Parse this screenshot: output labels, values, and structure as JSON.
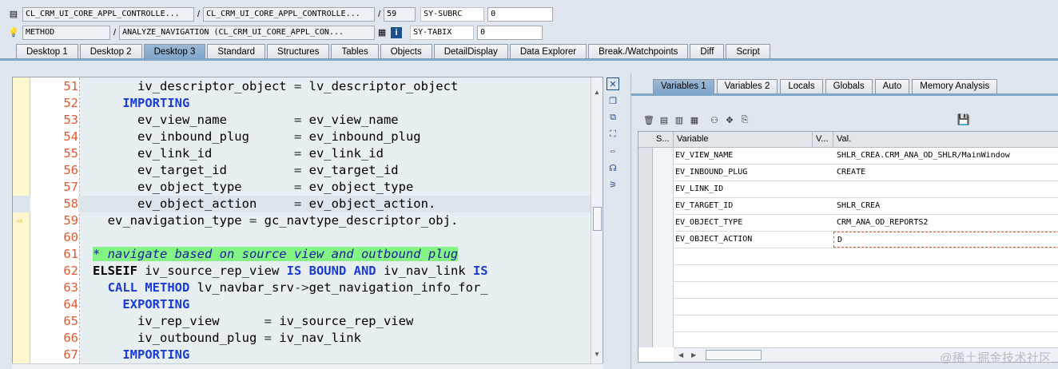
{
  "info": {
    "row1": {
      "field1": "CL_CRM_UI_CORE_APPL_CONTROLLE...",
      "field2": "CL_CRM_UI_CORE_APPL_CONTROLLE...",
      "line": "59",
      "label": "SY-SUBRC",
      "value": "0"
    },
    "row2": {
      "kind": "METHOD",
      "method": "ANALYZE_NAVIGATION (CL_CRM_UI_CORE_APPL_CON...",
      "label": "SY-TABIX",
      "value": "0"
    }
  },
  "tabs": [
    "Desktop 1",
    "Desktop 2",
    "Desktop 3",
    "Standard",
    "Structures",
    "Tables",
    "Objects",
    "DetailDisplay",
    "Data Explorer",
    "Break./Watchpoints",
    "Diff",
    "Script"
  ],
  "active_tab": "Desktop 3",
  "code": {
    "lines": [
      {
        "no": "51",
        "text": "      iv_descriptor_object = lv_descriptor_object"
      },
      {
        "no": "52",
        "text": "    IMPORTING"
      },
      {
        "no": "53",
        "text": "      ev_view_name         = ev_view_name"
      },
      {
        "no": "54",
        "text": "      ev_inbound_plug      = ev_inbound_plug"
      },
      {
        "no": "55",
        "text": "      ev_link_id           = ev_link_id"
      },
      {
        "no": "56",
        "text": "      ev_target_id         = ev_target_id"
      },
      {
        "no": "57",
        "text": "      ev_object_type       = ev_object_type"
      },
      {
        "no": "58",
        "text": "      ev_object_action     = ev_object_action."
      },
      {
        "no": "59",
        "text": "  ev_navigation_type = gc_navtype_descriptor_obj."
      },
      {
        "no": "60",
        "text": ""
      },
      {
        "no": "61",
        "text": "* navigate based on source view and outbound plug"
      },
      {
        "no": "62",
        "text": "ELSEIF iv_source_rep_view IS BOUND AND iv_nav_link IS"
      },
      {
        "no": "63",
        "text": "  CALL METHOD lv_navbar_srv->get_navigation_info_for_"
      },
      {
        "no": "64",
        "text": "    EXPORTING"
      },
      {
        "no": "65",
        "text": "      iv_rep_view      = iv_source_rep_view"
      },
      {
        "no": "66",
        "text": "      iv_outbound_plug = iv_nav_link"
      },
      {
        "no": "67",
        "text": "    IMPORTING"
      }
    ]
  },
  "right": {
    "tabs": [
      "Variables 1",
      "Variables 2",
      "Locals",
      "Globals",
      "Auto",
      "Memory Analysis"
    ],
    "active_tab": "Variables 1",
    "headers": {
      "s": "S...",
      "variable": "Variable",
      "v": "V...",
      "val": "Val."
    },
    "rows": [
      {
        "variable": "EV_VIEW_NAME",
        "value": "SHLR_CREA.CRM_ANA_OD_SHLR/MainWindow"
      },
      {
        "variable": "EV_INBOUND_PLUG",
        "value": "CREATE"
      },
      {
        "variable": "EV_LINK_ID",
        "value": ""
      },
      {
        "variable": "EV_TARGET_ID",
        "value": "SHLR_CREA"
      },
      {
        "variable": "EV_OBJECT_TYPE",
        "value": "CRM_ANA_OD_REPORTS2"
      },
      {
        "variable": "EV_OBJECT_ACTION",
        "value": "D"
      }
    ]
  },
  "watermark": "@稀土掘金技术社区"
}
